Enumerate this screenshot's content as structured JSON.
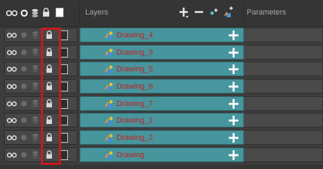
{
  "header": {
    "layers_label": "Layers",
    "parameters_label": "Parameters",
    "icons": [
      "show-all-icon",
      "show-hide-icon",
      "lock-all-icon",
      "color-swatch-icon",
      "add-layer-icon",
      "remove-layer-icon",
      "add-peg-icon",
      "add-drawing-icon"
    ]
  },
  "layers": [
    {
      "name": "Drawing_4"
    },
    {
      "name": "Drawing_3"
    },
    {
      "name": "Drawing_5"
    },
    {
      "name": "Drawing_6"
    },
    {
      "name": "Drawing_7"
    },
    {
      "name": "Drawing_1"
    },
    {
      "name": "Drawing_2"
    },
    {
      "name": "Drawing"
    }
  ],
  "row_icons": [
    "show-icon",
    "solo-icon",
    "stack-icon",
    "lock-icon",
    "color-swatch-icon"
  ],
  "colors": {
    "layer_row": "#47959d",
    "layer_name_text": "#c81e1e",
    "highlight_border": "#d01818",
    "panel_bg": "#3d3d3d"
  }
}
